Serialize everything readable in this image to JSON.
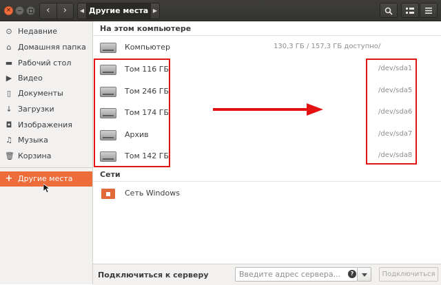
{
  "header": {
    "close_icon": "×",
    "back_icon": "‹",
    "forward_icon": "›",
    "path_left_icon": "◀",
    "path_current": "Другие места",
    "path_right_icon": "▶",
    "search_icon": "🔍",
    "view_icon": "⋮≡",
    "menu_icon": "≡"
  },
  "sidebar": {
    "items": [
      {
        "icon": "⊙",
        "label": "Недавние"
      },
      {
        "icon": "⌂",
        "label": "Домашняя папка"
      },
      {
        "icon": "▬",
        "label": "Рабочий стол"
      },
      {
        "icon": "▶",
        "label": "Видео"
      },
      {
        "icon": "▯",
        "label": "Документы"
      },
      {
        "icon": "↓",
        "label": "Загрузки"
      },
      {
        "icon": "◘",
        "label": "Изображения"
      },
      {
        "icon": "♫",
        "label": "Музыка"
      },
      {
        "icon": "🗑",
        "label": "Корзина"
      },
      {
        "icon": "+",
        "label": "Другие места"
      }
    ]
  },
  "main": {
    "on_this_computer": "На этом компьютере",
    "drives": [
      {
        "name": "Компьютер",
        "info": "130,3 ГБ / 157,3 ГБ доступно",
        "dev": "/"
      },
      {
        "name": "Том 116 ГБ",
        "info": "",
        "dev": "/dev/sda1"
      },
      {
        "name": "Том 246 ГБ",
        "info": "",
        "dev": "/dev/sda5"
      },
      {
        "name": "Том 174 ГБ",
        "info": "",
        "dev": "/dev/sda6"
      },
      {
        "name": "Архив",
        "info": "",
        "dev": "/dev/sda7"
      },
      {
        "name": "Том 142 ГБ",
        "info": "",
        "dev": "/dev/sda8"
      }
    ],
    "networks_title": "Сети",
    "networks": [
      {
        "name": "Сеть Windows"
      }
    ]
  },
  "bottom": {
    "connect_label": "Подключиться к серверу",
    "address_placeholder": "Введите адрес сервера...",
    "help_icon": "?",
    "connect_button": "Подключиться"
  },
  "colors": {
    "accent": "#ee6c3a",
    "annotation_red": "#e41111"
  }
}
